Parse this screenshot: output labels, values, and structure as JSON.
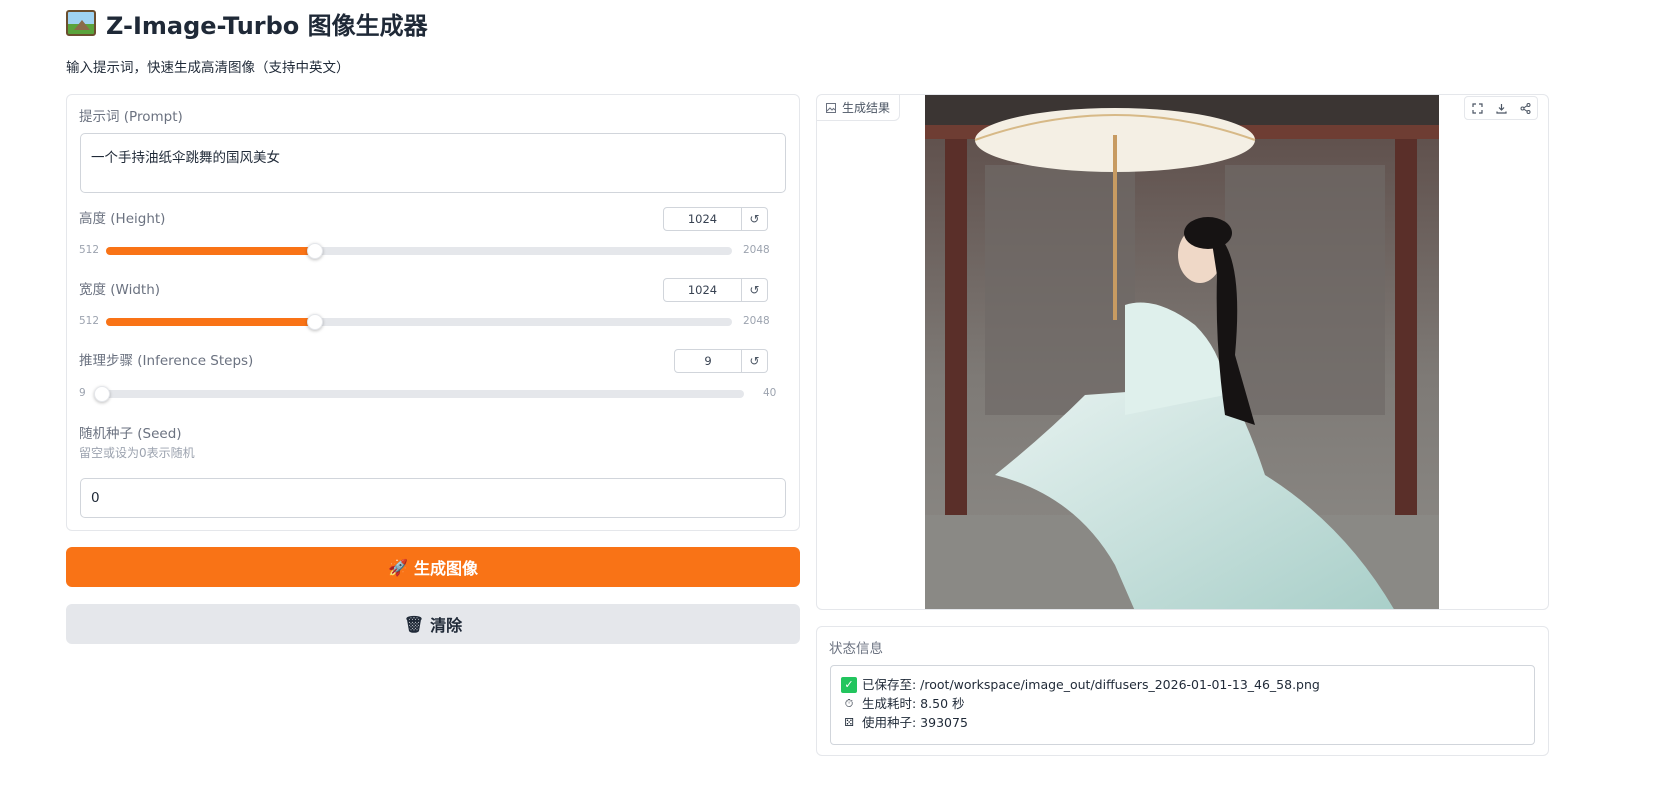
{
  "header": {
    "title": "Z-Image-Turbo 图像生成器",
    "subtitle": "输入提示词，快速生成高清图像（支持中英文）"
  },
  "form": {
    "prompt": {
      "label": "提示词 (Prompt)",
      "value": "一个手持油纸伞跳舞的国风美女"
    },
    "height": {
      "label": "高度 (Height)",
      "value": "1024",
      "min": "512",
      "max": "2048",
      "fraction": 0.3333
    },
    "width": {
      "label": "宽度 (Width)",
      "value": "1024",
      "min": "512",
      "max": "2048",
      "fraction": 0.3333
    },
    "steps": {
      "label": "推理步骤 (Inference Steps)",
      "value": "9",
      "min": "9",
      "max": "40",
      "fraction": 0
    },
    "seed": {
      "label": "随机种子 (Seed)",
      "hint": "留空或设为0表示随机",
      "value": "0"
    },
    "reset_glyph": "↺"
  },
  "buttons": {
    "generate_icon": "🚀",
    "generate": "生成图像",
    "clear_icon": "🗑",
    "clear": "清除"
  },
  "result": {
    "label": "生成结果"
  },
  "status": {
    "label": "状态信息",
    "saved_check": "✓",
    "saved": "已保存至: /root/workspace/image_out/diffusers_2026-01-01-13_46_58.png",
    "time_icon": "⏱",
    "time": "生成耗时: 8.50 秒",
    "seed_icon": "⚄",
    "seed": "使用种子: 393075"
  },
  "colors": {
    "accent": "#f97316",
    "secondary_button": "#e5e7eb"
  }
}
